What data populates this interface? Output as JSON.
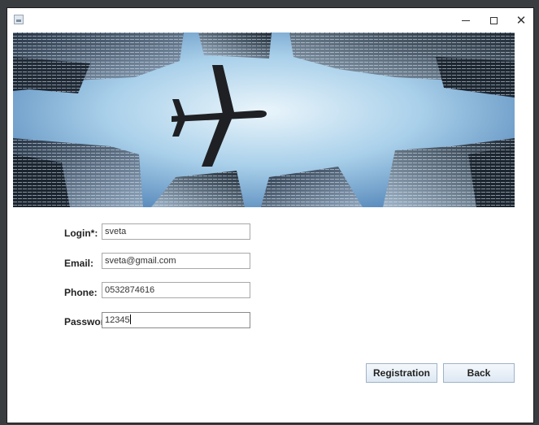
{
  "window": {
    "controls": {
      "minimize_icon": "minimize-icon",
      "maximize_icon": "maximize-icon",
      "close_icon": "close-icon"
    }
  },
  "form": {
    "login": {
      "label": "Login*:",
      "value": "sveta"
    },
    "email": {
      "label": "Email:",
      "value": "sveta@gmail.com"
    },
    "phone": {
      "label": "Phone:",
      "value": "0532874616"
    },
    "password": {
      "label": "Password*:",
      "value": "12345"
    }
  },
  "buttons": {
    "registration": "Registration",
    "back": "Back"
  },
  "colors": {
    "sky_top": "#4f86c0",
    "sky_center": "#cfe6f5",
    "building": "#1f2a36",
    "button_border": "#9fb2c8"
  }
}
